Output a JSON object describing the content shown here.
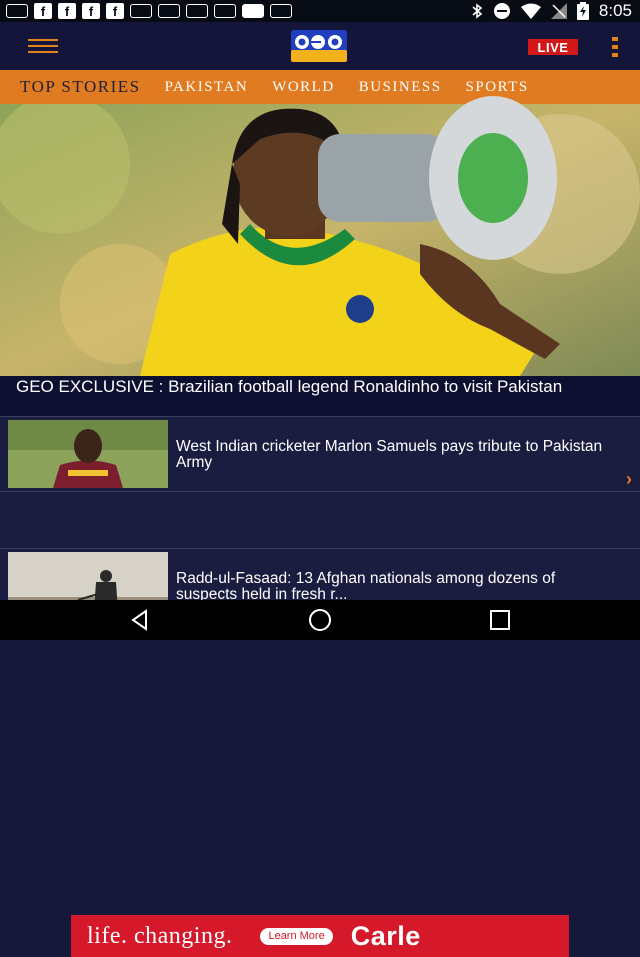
{
  "status_bar": {
    "time": "8:05",
    "icons": [
      "message-icon",
      "facebook-icon",
      "facebook-icon",
      "facebook-icon",
      "facebook-icon",
      "voicemail-icon",
      "voicemail-icon",
      "voicemail-icon",
      "voicemail-icon",
      "image-icon",
      "voicemail-icon",
      "bluetooth-icon",
      "do-not-disturb-icon",
      "wifi-icon",
      "no-signal-icon",
      "battery-icon"
    ]
  },
  "header": {
    "logo_alt": "Geo News",
    "live_label": "LIVE"
  },
  "tabs": [
    {
      "label": "Top Stories",
      "active": true
    },
    {
      "label": "Pakistan",
      "active": false
    },
    {
      "label": "World",
      "active": false
    },
    {
      "label": "Business",
      "active": false
    },
    {
      "label": "Sports",
      "active": false
    }
  ],
  "top_story": {
    "headline": "GEO EXCLUSIVE : Brazilian football legend Ronaldinho to visit Pakistan"
  },
  "stories": [
    {
      "title": "West Indian cricketer Marlon Samuels pays tribute to Pakistan Army"
    },
    {
      "title": "Radd-ul-Fasaad: 13 Afghan nationals among dozens of suspects held in fresh r..."
    }
  ],
  "ad": {
    "tagline": "life. changing.",
    "button": "Learn More",
    "brand": "Carle"
  },
  "colors": {
    "accent": "#e07b21",
    "background": "#15183a",
    "live": "#d21919",
    "ad": "#d5192b"
  }
}
